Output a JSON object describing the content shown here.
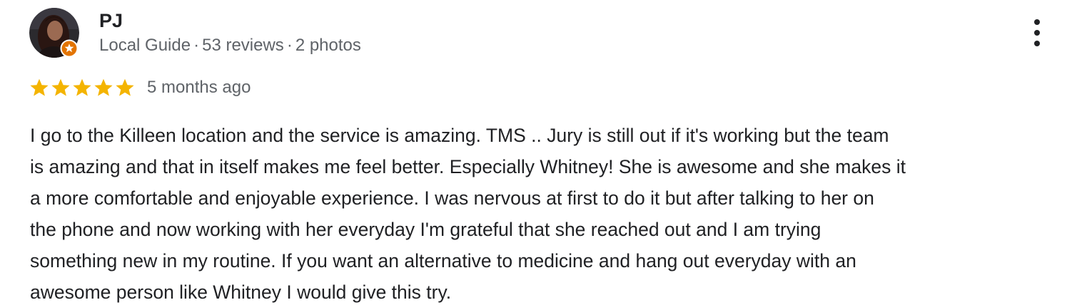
{
  "reviewer": {
    "name": "PJ",
    "badge": "Local Guide",
    "separator": "·",
    "reviews": "53 reviews",
    "photos": "2 photos",
    "avatar_icon": "profile-photo",
    "badge_icon": "local-guide-star-icon"
  },
  "review": {
    "rating": 5,
    "max_rating": 5,
    "date": "5 months ago",
    "text_lines": [
      "I go to the Killeen location and the service is amazing. TMS .. Jury is still out if it's working but the team",
      "is amazing and that in itself makes me feel better. Especially Whitney! She is awesome and she makes it",
      "a more comfortable and enjoyable experience. I was nervous at first to do it but after talking to her on",
      "the phone and now working with her everyday I'm grateful that she reached out and I am trying",
      "something new in my routine. If you want an alternative to medicine and hang out everyday with an",
      "awesome person like Whitney I would give this try."
    ]
  },
  "menu": {
    "icon": "more-vert-icon"
  },
  "colors": {
    "star": "#F4B400",
    "badge": "#E37400",
    "text": "#202124",
    "secondary_text": "#5f6368"
  }
}
